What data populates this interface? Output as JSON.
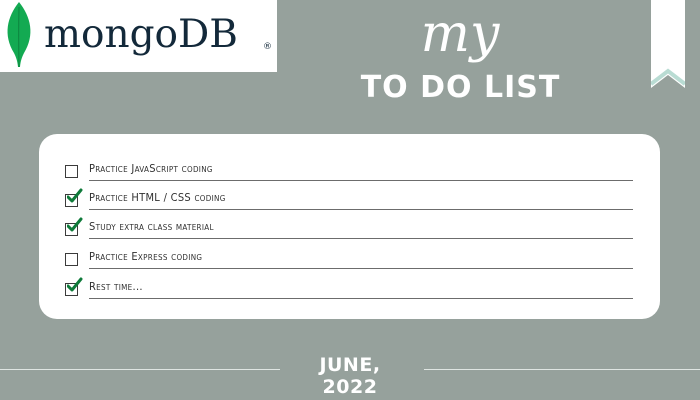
{
  "logo": {
    "text": "mongoDB",
    "registered": "®",
    "leaf_color": "#13aa52",
    "text_color": "#13293a",
    "icon": "mongodb-leaf-icon"
  },
  "header": {
    "script_title": "my",
    "title": "TO DO LIST"
  },
  "tasks": [
    {
      "label": "Practice JavaScript coding",
      "checked": false
    },
    {
      "label": "Practice HTML / CSS coding",
      "checked": true
    },
    {
      "label": "Study extra class material",
      "checked": true
    },
    {
      "label": "Practice Express coding",
      "checked": false
    },
    {
      "label": "Rest time...",
      "checked": true
    }
  ],
  "footer": {
    "date": "JUNE, 2022"
  },
  "colors": {
    "background": "#96a19c",
    "card": "#ffffff",
    "check": "#0f7a3a",
    "ribbon": "#ffffff",
    "ribbon_accent": "#b9dcd3"
  },
  "icons": {
    "checkbox": "checkbox-icon",
    "checkmark": "checkmark-icon",
    "bookmark": "bookmark-ribbon-icon"
  }
}
